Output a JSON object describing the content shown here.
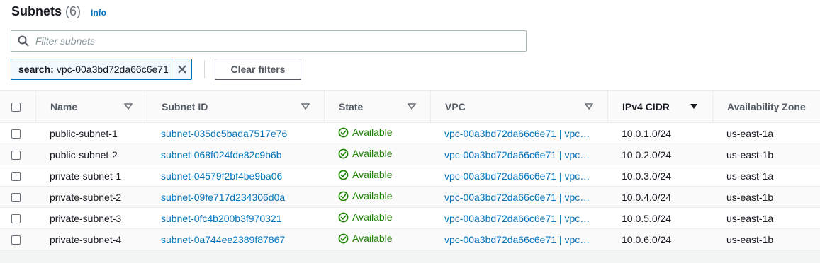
{
  "header": {
    "title": "Subnets",
    "count": "(6)",
    "info_label": "Info"
  },
  "search": {
    "placeholder": "Filter subnets",
    "value": ""
  },
  "filter_token": {
    "key": "search:",
    "value": "vpc-00a3bd72da66c6e71"
  },
  "clear_filters_label": "Clear filters",
  "table": {
    "columns": [
      {
        "label": "Name",
        "icon": "filter-caret-icon"
      },
      {
        "label": "Subnet ID",
        "icon": "filter-caret-icon"
      },
      {
        "label": "State",
        "icon": "filter-caret-icon"
      },
      {
        "label": "VPC",
        "icon": "filter-caret-icon"
      },
      {
        "label": "IPv4 CIDR",
        "icon": "sort-descending-icon"
      },
      {
        "label": "Availability Zone",
        "icon": ""
      }
    ],
    "rows": [
      {
        "name": "public-subnet-1",
        "subnet_id": "subnet-035dc5bada7517e76",
        "state": "Available",
        "vpc": "vpc-00a3bd72da66c6e71 | vpc…",
        "cidr": "10.0.1.0/24",
        "az": "us-east-1a"
      },
      {
        "name": "public-subnet-2",
        "subnet_id": "subnet-068f024fde82c9b6b",
        "state": "Available",
        "vpc": "vpc-00a3bd72da66c6e71 | vpc…",
        "cidr": "10.0.2.0/24",
        "az": "us-east-1b"
      },
      {
        "name": "private-subnet-1",
        "subnet_id": "subnet-04579f2bf4be9ba06",
        "state": "Available",
        "vpc": "vpc-00a3bd72da66c6e71 | vpc…",
        "cidr": "10.0.3.0/24",
        "az": "us-east-1a"
      },
      {
        "name": "private-subnet-2",
        "subnet_id": "subnet-09fe717d234306d0a",
        "state": "Available",
        "vpc": "vpc-00a3bd72da66c6e71 | vpc…",
        "cidr": "10.0.4.0/24",
        "az": "us-east-1b"
      },
      {
        "name": "private-subnet-3",
        "subnet_id": "subnet-0fc4b200b3f970321",
        "state": "Available",
        "vpc": "vpc-00a3bd72da66c6e71 | vpc…",
        "cidr": "10.0.5.0/24",
        "az": "us-east-1a"
      },
      {
        "name": "private-subnet-4",
        "subnet_id": "subnet-0a744ee2389f87867",
        "state": "Available",
        "vpc": "vpc-00a3bd72da66c6e71 | vpc…",
        "cidr": "10.0.6.0/24",
        "az": "us-east-1b"
      }
    ]
  },
  "colors": {
    "link": "#0073bb",
    "success": "#1d8102",
    "text": "#16191f",
    "muted": "#545b64"
  }
}
